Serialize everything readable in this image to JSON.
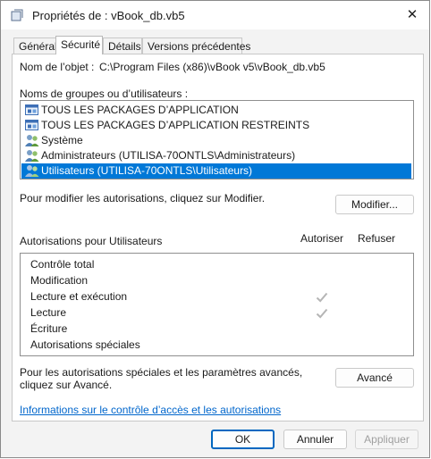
{
  "window": {
    "title": "Propriétés de : vBook_db.vb5",
    "close_glyph": "✕"
  },
  "tabs": [
    {
      "label": "Général"
    },
    {
      "label": "Sécurité"
    },
    {
      "label": "Détails"
    },
    {
      "label": "Versions précédentes"
    }
  ],
  "active_tab": "Sécurité",
  "security": {
    "object_label": "Nom de l’objet :",
    "object_value": "C:\\Program Files (x86)\\vBook v5\\vBook_db.vb5",
    "groups_label": "Noms de groupes ou d’utilisateurs :",
    "groups": [
      {
        "name": "TOUS LES PACKAGES D’APPLICATION",
        "icon": "app-package-icon",
        "selected": false
      },
      {
        "name": "TOUS LES PACKAGES D’APPLICATION RESTREINTS",
        "icon": "app-package-icon",
        "selected": false
      },
      {
        "name": "Système",
        "icon": "users-icon",
        "selected": false
      },
      {
        "name": "Administrateurs (UTILISA-70ONTLS\\Administrateurs)",
        "icon": "users-icon",
        "selected": false
      },
      {
        "name": "Utilisateurs (UTILISA-70ONTLS\\Utilisateurs)",
        "icon": "users-icon",
        "selected": true
      }
    ],
    "modify_text": "Pour modifier les autorisations, cliquez sur Modifier.",
    "modify_button": "Modifier...",
    "permissions_label": "Autorisations pour Utilisateurs",
    "allow_header": "Autoriser",
    "deny_header": "Refuser",
    "permissions": [
      {
        "name": "Contrôle total",
        "allow": false,
        "deny": false
      },
      {
        "name": "Modification",
        "allow": false,
        "deny": false
      },
      {
        "name": "Lecture et exécution",
        "allow": true,
        "deny": false
      },
      {
        "name": "Lecture",
        "allow": true,
        "deny": false
      },
      {
        "name": "Écriture",
        "allow": false,
        "deny": false
      },
      {
        "name": "Autorisations spéciales",
        "allow": false,
        "deny": false
      }
    ],
    "special_text": "Pour les autorisations spéciales et les paramètres avancés, cliquez sur Avancé.",
    "advanced_button": "Avancé",
    "help_link": "Informations sur le contrôle d’accès et les autorisations"
  },
  "footer": {
    "ok": "OK",
    "cancel": "Annuler",
    "apply": "Appliquer"
  },
  "colors": {
    "selection": "#0078d7",
    "link": "#0066cc",
    "check": "#b5b5b5"
  }
}
